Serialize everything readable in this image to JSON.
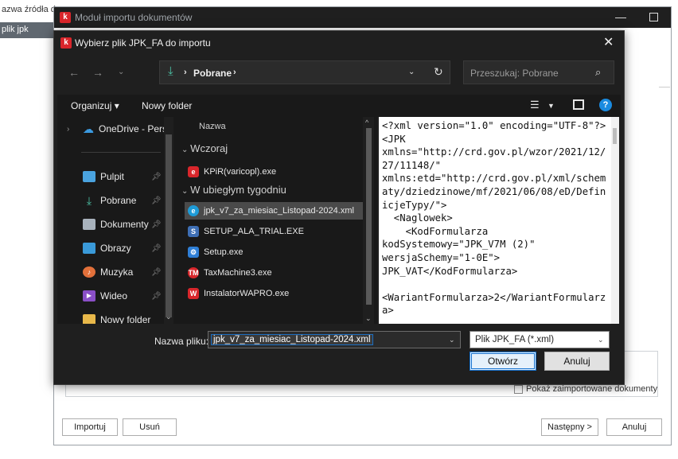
{
  "background": {
    "row1": "azwa źródła d",
    "row2": "plik jpk"
  },
  "module_window": {
    "title": "Moduł importu dokumentów",
    "show_imported_label": "Pokaż zaimportowane dokumenty",
    "buttons": {
      "import": "Importuj",
      "remove": "Usuń",
      "next": "Następny >",
      "cancel": "Anuluj"
    }
  },
  "dialog": {
    "title": "Wybierz plik JPK_FA do importu",
    "address": {
      "current_folder": "Pobrane"
    },
    "search_placeholder": "Przeszukaj: Pobrane",
    "toolbar": {
      "organize": "Organizuj ▾",
      "new_folder": "Nowy folder"
    },
    "nav_items": [
      {
        "label": "OneDrive - Perso",
        "icon": "cloud-icon",
        "color": "#3b9ae0"
      },
      {
        "label": "Pulpit",
        "icon": "desktop-icon",
        "color": "#4aa3df"
      },
      {
        "label": "Pobrane",
        "icon": "download-icon",
        "color": "#4cc2a6"
      },
      {
        "label": "Dokumenty",
        "icon": "documents-icon",
        "color": "#a9b3bd"
      },
      {
        "label": "Obrazy",
        "icon": "pictures-icon",
        "color": "#3a9ad9"
      },
      {
        "label": "Muzyka",
        "icon": "music-icon",
        "color": "#e2703a"
      },
      {
        "label": "Wideo",
        "icon": "video-icon",
        "color": "#8a4fc7"
      },
      {
        "label": "Nowy folder",
        "icon": "folder-icon",
        "color": "#e8b84a"
      }
    ],
    "file_list": {
      "column_header": "Nazwa",
      "groups": [
        {
          "label": "Wczoraj",
          "files": [
            {
              "name": "KPiR(varicopl).exe",
              "icon": "kpir-icon",
              "color": "#d9262b"
            }
          ]
        },
        {
          "label": "W ubiegłym tygodniu",
          "files": [
            {
              "name": "jpk_v7_za_miesiac_Listopad-2024.xml",
              "icon": "edge-xml-icon",
              "color": "#1e9bd7",
              "selected": true
            },
            {
              "name": "SETUP_ALA_TRIAL.EXE",
              "icon": "setup-icon",
              "color": "#3e6fb5"
            },
            {
              "name": "Setup.exe",
              "icon": "setup-exe-icon",
              "color": "#2f7fd6"
            },
            {
              "name": "TaxMachine3.exe",
              "icon": "taxmachine-icon",
              "color": "#d9262b"
            },
            {
              "name": "InstalatorWAPRO.exe",
              "icon": "wapro-icon",
              "color": "#d9262b"
            }
          ]
        }
      ]
    },
    "preview_text": "<?xml version=\"1.0\" encoding=\"UTF-8\"?>\n<JPK\nxmlns=\"http://crd.gov.pl/wzor/2021/12/\n27/11148/\"\nxmlns:etd=\"http://crd.gov.pl/xml/schem\naty/dziedzinowe/mf/2021/06/08/eD/Defin\nicjeTypy/\">\n  <Naglowek>\n    <KodFormularza\nkodSystemowy=\"JPK_V7M (2)\"\nwersjaSchemy=\"1-0E\">\nJPK_VAT</KodFormularza>\n\n<WariantFormularza>2</WariantFormularz\na>",
    "filename_label": "Nazwa pliku:",
    "filename_value": "jpk_v7_za_miesiac_Listopad-2024.xml",
    "filetype_value": "Plik JPK_FA (*.xml)",
    "open_button": "Otwórz",
    "cancel_button": "Anuluj"
  }
}
